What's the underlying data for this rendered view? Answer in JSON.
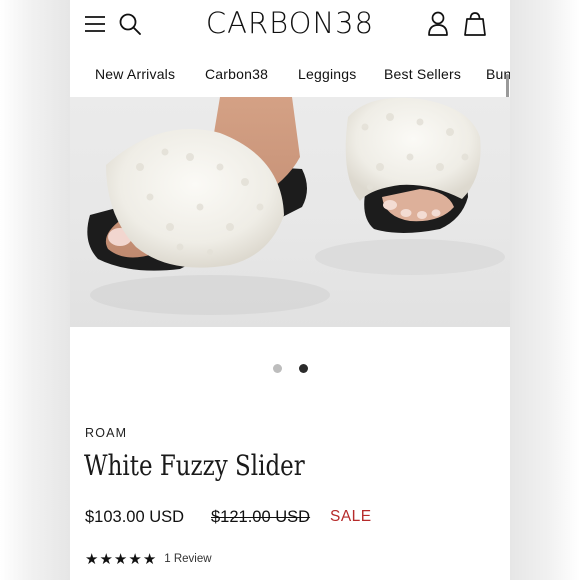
{
  "header": {
    "logo": "CARBON38",
    "icons": [
      "menu-icon",
      "search-icon",
      "account-icon",
      "cart-icon"
    ]
  },
  "nav": {
    "items": [
      {
        "label": "New Arrivals"
      },
      {
        "label": "Carbon38"
      },
      {
        "label": "Leggings"
      },
      {
        "label": "Best Sellers"
      },
      {
        "label": "Bun"
      }
    ]
  },
  "carousel": {
    "slide_count": 2,
    "active_index": 1,
    "dot_colors": {
      "inactive": "#bdbdbd",
      "active": "#2b2b2b"
    }
  },
  "product": {
    "brand": "ROAM",
    "title": "White Fuzzy Slider",
    "price": "$103.00 USD",
    "compare_price": "$121.00 USD",
    "sale_label": "SALE",
    "rating": 5,
    "review_count": "1 Review"
  },
  "colors": {
    "sale": "#b62b2b",
    "text": "#111111",
    "background": "#ffffff"
  }
}
